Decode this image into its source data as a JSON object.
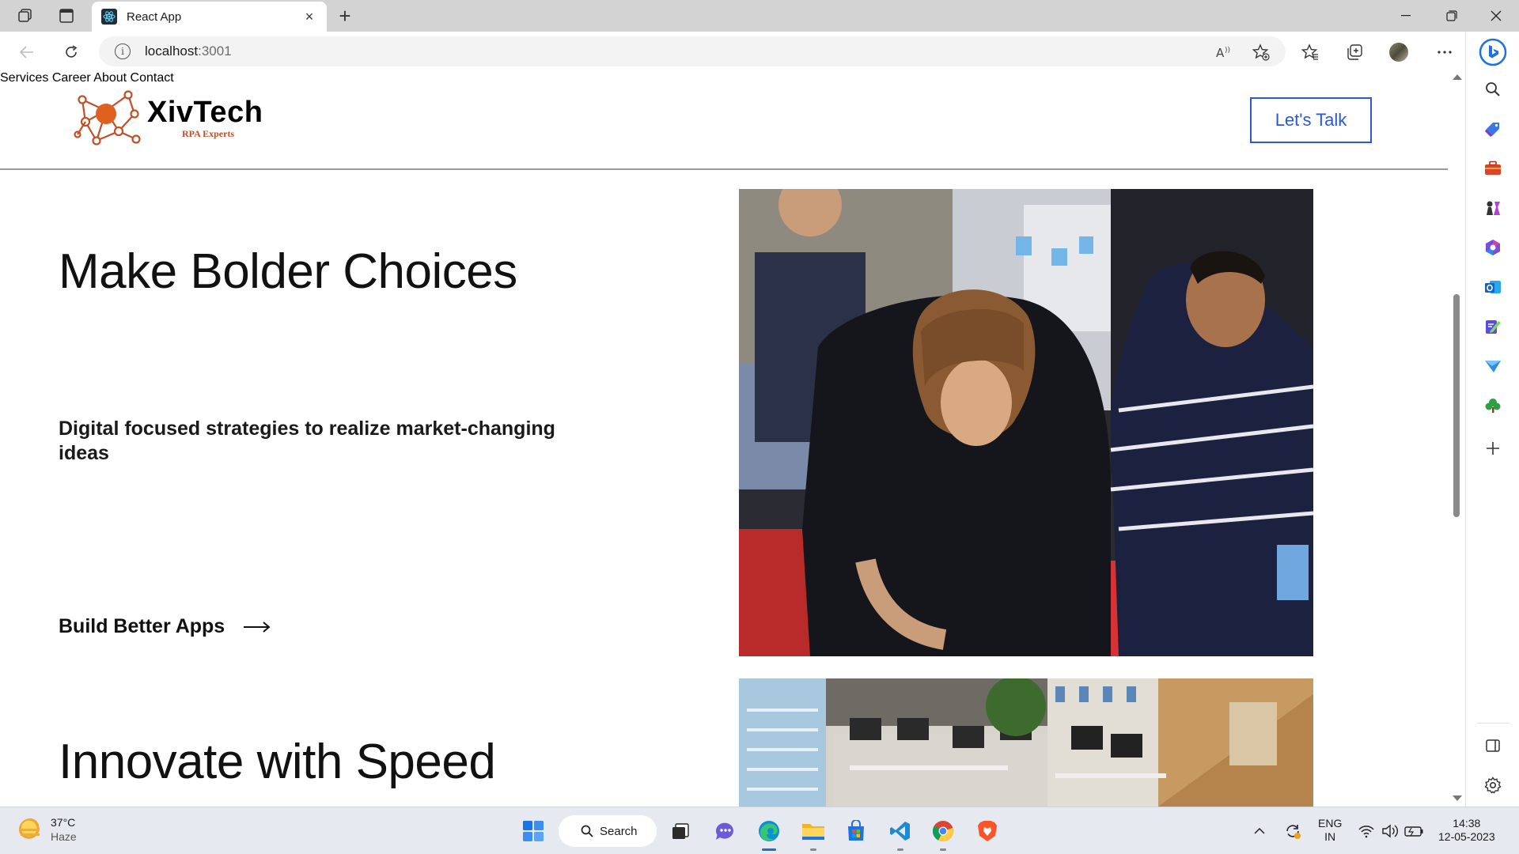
{
  "browser": {
    "tab_title": "React App",
    "url_host": "localhost",
    "url_port": ":3001"
  },
  "site": {
    "brand_name": "XivTech",
    "brand_tagline": "RPA Experts",
    "nav": {
      "services": "Services",
      "career": "Career",
      "about": "About",
      "contact": "Contact",
      "cta": "Let's Talk"
    },
    "hero": {
      "heading": "Make Bolder Choices",
      "subheading": "Digital focused strategies to realize market-changing ideas",
      "link": "Build Better Apps"
    },
    "section2": {
      "heading": "Innovate with Speed"
    }
  },
  "taskbar": {
    "weather_temp": "37°C",
    "weather_desc": "Haze",
    "search_label": "Search",
    "lang": "ENG",
    "region": "IN",
    "time": "14:38",
    "date": "12-05-2023"
  },
  "colors": {
    "accent": "#2b57d8",
    "brand_orange": "#c0502a"
  }
}
